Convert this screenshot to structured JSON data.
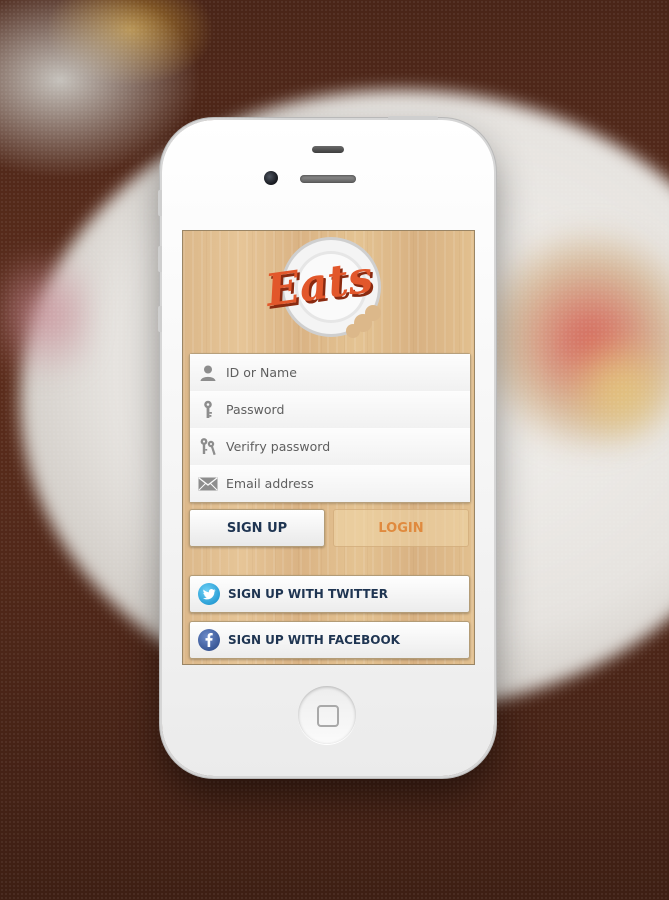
{
  "app": {
    "logo_text": "Eats"
  },
  "form": {
    "fields": [
      {
        "name": "id",
        "placeholder": "ID or Name",
        "value": "",
        "icon": "user-icon"
      },
      {
        "name": "password",
        "placeholder": "Password",
        "value": "",
        "icon": "key-icon"
      },
      {
        "name": "verify_password",
        "placeholder": "Verifry password",
        "value": "",
        "icon": "keys-icon"
      },
      {
        "name": "email",
        "placeholder": "Email address",
        "value": "",
        "icon": "envelope-icon"
      }
    ]
  },
  "buttons": {
    "signup_label": "SIGN UP",
    "login_label": "LOGIN"
  },
  "social": {
    "twitter_label": "SIGN UP WITH TWITTER",
    "twitter_icon": "twitter-icon",
    "facebook_label": "SIGN UP WITH FACEBOOK",
    "facebook_icon": "facebook-icon"
  },
  "colors": {
    "brand_orange": "#e2572b",
    "navy_text": "#1f3552",
    "login_text": "#e08a3e",
    "twitter_blue": "#2a9fd6",
    "facebook_blue": "#3b5998"
  }
}
